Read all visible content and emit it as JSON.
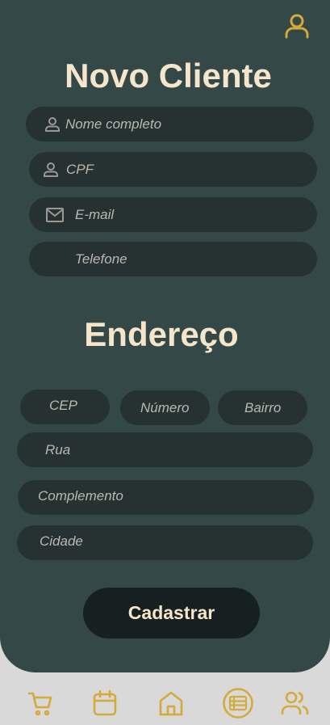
{
  "header": {
    "title": "Novo Cliente",
    "profile_icon": "user-icon"
  },
  "cliente": {
    "nome": {
      "placeholder": "Nome completo",
      "icon": "user-icon"
    },
    "cpf": {
      "placeholder": "CPF",
      "icon": "user-icon"
    },
    "email": {
      "placeholder": "E-mail",
      "icon": "mail-icon"
    },
    "telefone": {
      "placeholder": "Telefone"
    }
  },
  "endereco": {
    "title": "Endereço",
    "cep": {
      "placeholder": "CEP"
    },
    "numero": {
      "placeholder": "Número"
    },
    "bairro": {
      "placeholder": "Bairro"
    },
    "rua": {
      "placeholder": "Rua"
    },
    "complemento": {
      "placeholder": "Complemento"
    },
    "cidade": {
      "placeholder": "Cidade"
    }
  },
  "actions": {
    "submit_label": "Cadastrar"
  },
  "nav": {
    "items": [
      {
        "icon": "cart-icon"
      },
      {
        "icon": "calendar-icon"
      },
      {
        "icon": "home-icon"
      },
      {
        "icon": "list-icon",
        "active": true
      },
      {
        "icon": "users-icon"
      }
    ]
  },
  "colors": {
    "panel": "#354848",
    "field": "#263232",
    "title": "#f4e5cb",
    "accent": "#d4aa3a",
    "button": "#162020",
    "nav_background": "#d9d9d9"
  }
}
